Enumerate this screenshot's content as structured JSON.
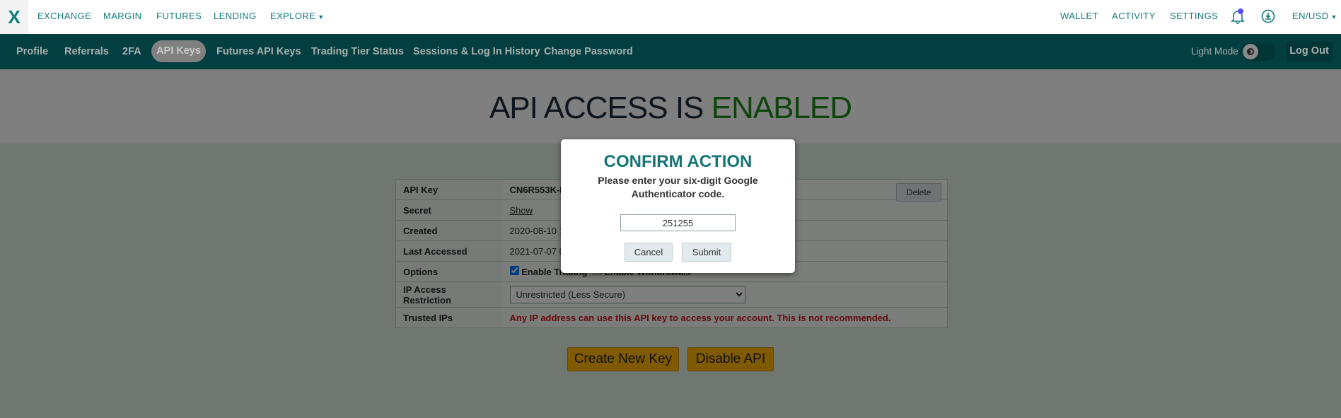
{
  "topnav": {
    "logo": "X",
    "items": [
      "EXCHANGE",
      "MARGIN",
      "FUTURES",
      "LENDING",
      "EXPLORE"
    ],
    "right": [
      "WALLET",
      "ACTIVITY",
      "SETTINGS"
    ],
    "locale": "EN/USD",
    "notification_color": "#5a4cf0"
  },
  "subnav": {
    "items": [
      "Profile",
      "Referrals",
      "2FA",
      "API Keys",
      "Futures API Keys",
      "Trading Tier Status",
      "Sessions & Log In History",
      "Change Password"
    ],
    "active": "API Keys",
    "light_mode": "Light Mode",
    "logout": "Log Out"
  },
  "hero": {
    "prefix": "API ACCESS IS",
    "status": "ENABLED"
  },
  "table": {
    "labels": [
      "API Key",
      "Secret",
      "Created",
      "Last Accessed",
      "Options",
      "IP Access Restriction",
      "Trusted IPs"
    ],
    "api_key": "CN6R553K-P",
    "secret": "Show",
    "created": "2020-08-10 1",
    "last_accessed": "2021-07-07 0",
    "enable_trading": "Enable Trading",
    "enable_withdrawals": "Enable Withdrawals",
    "ip_restriction": "Unrestricted (Less Secure)",
    "warning": "Any IP address can use this API key to access your account. This is not recommended.",
    "delete": "Delete"
  },
  "actions": {
    "create": "Create New Key",
    "disable": "Disable API"
  },
  "modal": {
    "title": "CONFIRM ACTION",
    "message": "Please enter your six-digit Google Authenticator code.",
    "code": "251255",
    "cancel": "Cancel",
    "submit": "Submit"
  }
}
